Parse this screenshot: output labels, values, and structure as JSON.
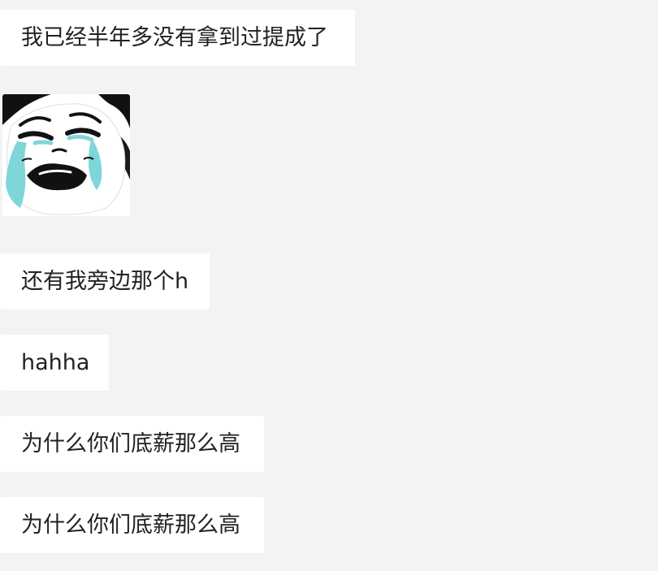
{
  "messages": [
    {
      "text": "我已经半年多没有拿到过提成了"
    },
    {
      "type": "sticker",
      "icon": "crying-panda-sticker"
    },
    {
      "text": "还有我旁边那个h"
    },
    {
      "text": "hahha"
    },
    {
      "text": "为什么你们底薪那么高"
    },
    {
      "text": "为什么你们底薪那么高"
    }
  ],
  "colors": {
    "background": "#f3f3f3",
    "bubble": "#ffffff",
    "text": "#222222",
    "tears": "#7fd6d8"
  }
}
